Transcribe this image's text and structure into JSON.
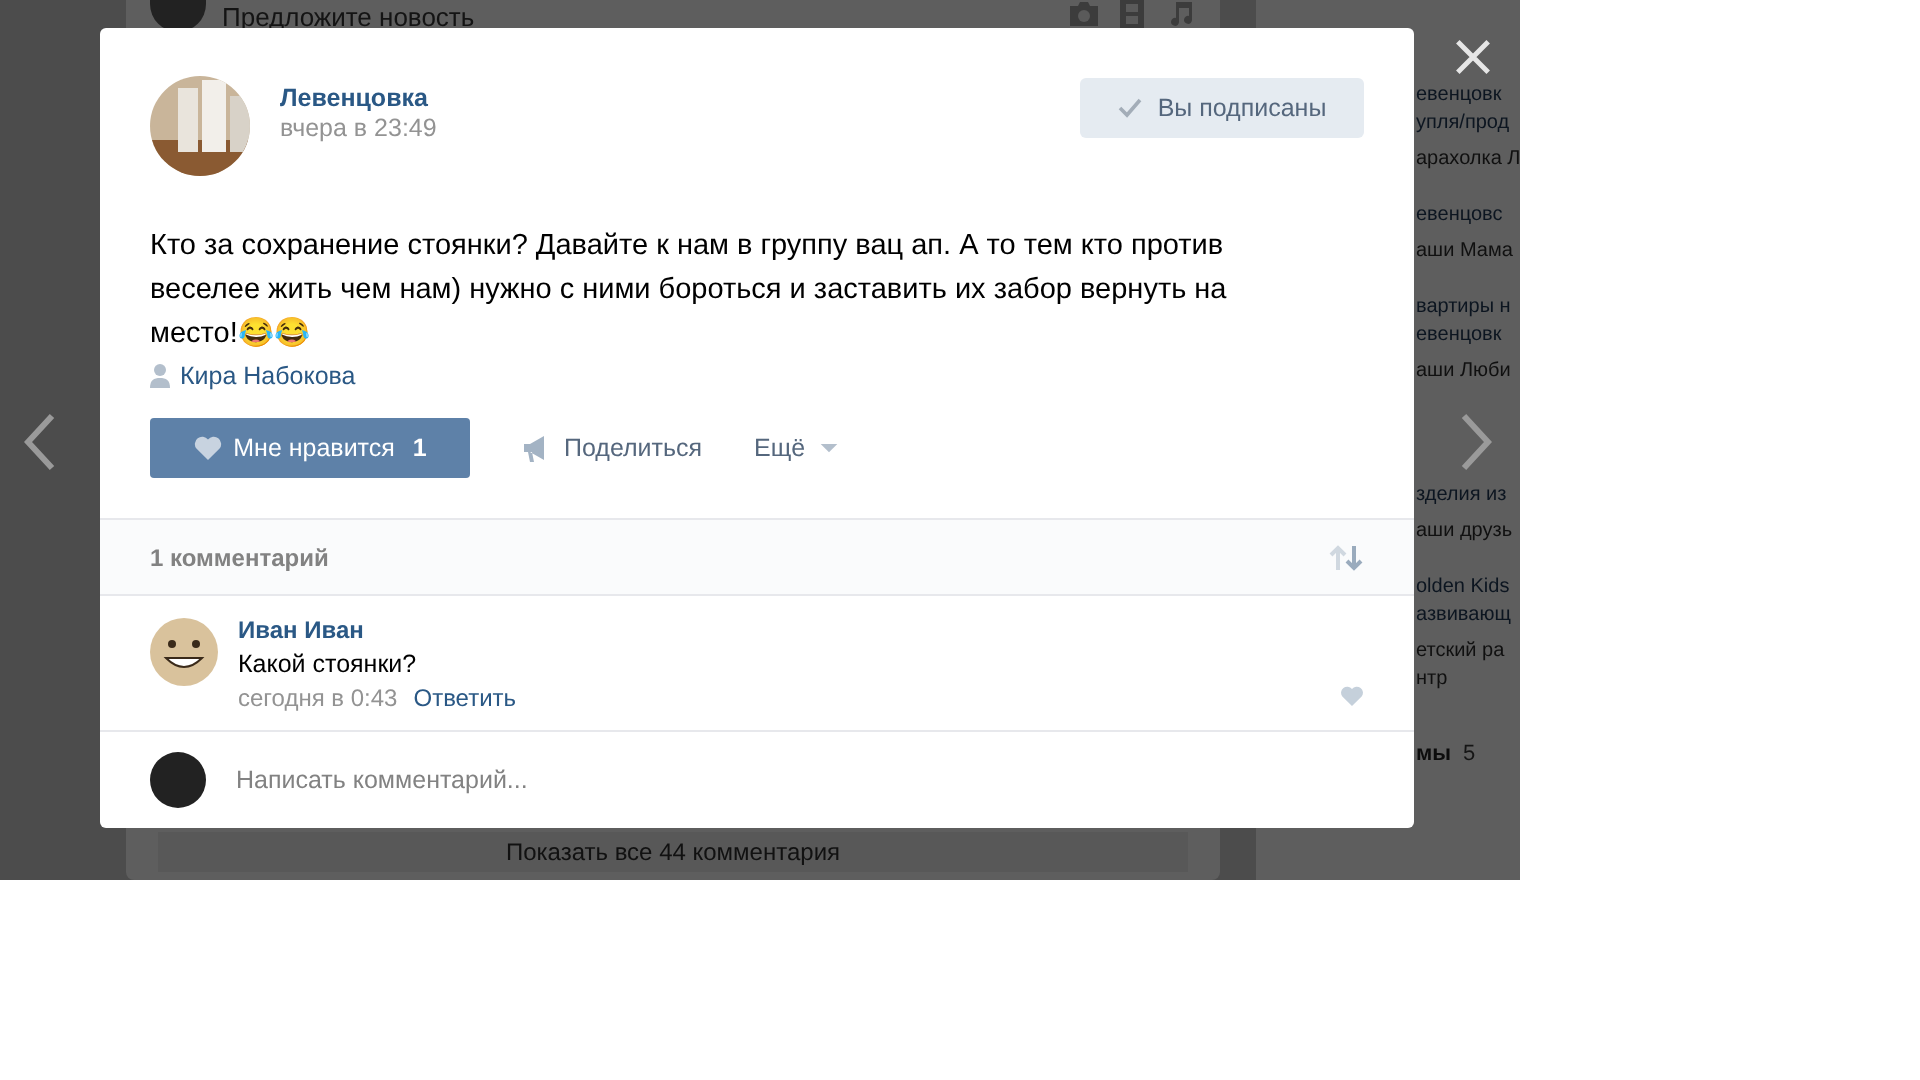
{
  "background_page": {
    "composer": {
      "placeholder": "Предложите новость"
    },
    "show_all_comments": "Показать все 44 комментария",
    "sidebar_items": [
      {
        "lines": [
          "евенцовк",
          "упля/прод"
        ],
        "sub": "арахолка Л"
      },
      {
        "lines": [
          "евенцовс"
        ],
        "sub": "аши Мама"
      },
      {
        "lines": [
          "вартиры н",
          "евенцовк"
        ],
        "sub": "аши Люби"
      },
      {
        "lines": [
          "зделия из"
        ],
        "sub": "аши друзь"
      },
      {
        "lines": [
          "olden Kids",
          "азвивающ"
        ],
        "sub": "етский ра",
        "sub2": "нтр"
      }
    ],
    "sidebar_section": {
      "label": "мы",
      "count": "5"
    }
  },
  "post": {
    "author": "Левенцовка",
    "time": "вчера в 23:49",
    "subscribe_button": {
      "label": "Вы подписаны",
      "subscribed": true
    },
    "text": "Кто за сохранение стоянки? Давайте к нам в группу вац ап. А то тем кто против веселее жить чем нам) нужно с ними бороться и заставить их забор вернуть на место!😂😂",
    "signer": "Кира Набокова",
    "actions": [
      {
        "kind": "like",
        "label": "Мне нравится",
        "count": "1",
        "liked": true
      },
      {
        "kind": "share",
        "label": "Поделиться"
      },
      {
        "kind": "more",
        "label": "Ещё"
      }
    ]
  },
  "comments": {
    "count_label": "1 комментарий",
    "items": [
      {
        "author": "Иван Иван",
        "text": "Какой стоянки?",
        "time": "сегодня в 0:43",
        "reply": "Ответить"
      }
    ]
  },
  "comment_field": {
    "placeholder": "Написать комментарий..."
  }
}
